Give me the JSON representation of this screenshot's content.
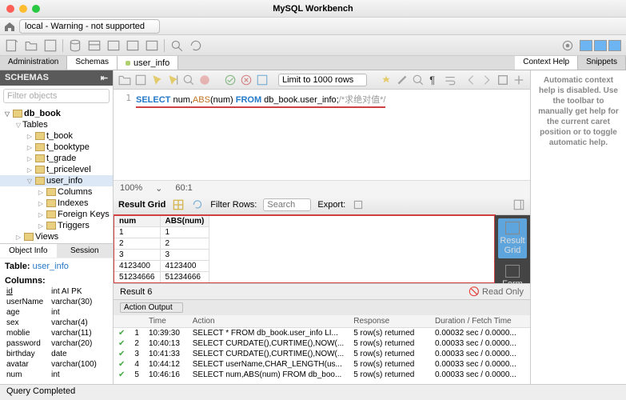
{
  "app_title": "MySQL Workbench",
  "connection_tab": "local - Warning - not supported",
  "top_tabs": {
    "admin": "Administration",
    "schemas": "Schemas",
    "editor": "user_info",
    "context": "Context Help",
    "snippets": "Snippets"
  },
  "sidebar": {
    "title": "SCHEMAS",
    "search_placeholder": "Filter objects",
    "db": "db_book",
    "tables_label": "Tables",
    "tables": [
      "t_book",
      "t_booktype",
      "t_grade",
      "t_pricelevel"
    ],
    "active_table": "user_info",
    "children": [
      "Columns",
      "Indexes",
      "Foreign Keys",
      "Triggers"
    ],
    "views": "Views",
    "tabs": {
      "object": "Object Info",
      "session": "Session"
    },
    "info_prefix": "Table:",
    "info_table": "user_info",
    "cols_header": "Columns:",
    "cols": [
      {
        "n": "id",
        "t": "int AI PK"
      },
      {
        "n": "userName",
        "t": "varchar(30)"
      },
      {
        "n": "age",
        "t": "int"
      },
      {
        "n": "sex",
        "t": "varchar(4)"
      },
      {
        "n": "moblie",
        "t": "varchar(11)"
      },
      {
        "n": "password",
        "t": "varchar(20)"
      },
      {
        "n": "birthday",
        "t": "date"
      },
      {
        "n": "avatar",
        "t": "varchar(100)"
      },
      {
        "n": "num",
        "t": "int"
      }
    ]
  },
  "editor_toolbar": {
    "limit": "Limit to 1000 rows"
  },
  "sql": {
    "line_no": "1",
    "select": "SELECT",
    "cols": " num,",
    "abs": "ABS",
    "args": "(num) ",
    "from": "FROM",
    "table": " db_book.user_info",
    "semi": ";",
    "comment": "/*求绝对值*/",
    "zoom": "100%",
    "pos": "60:1"
  },
  "result_toolbar": {
    "label": "Result Grid",
    "filter": "Filter Rows:",
    "search_ph": "Search",
    "export": "Export:"
  },
  "grid": {
    "headers": [
      "num",
      "ABS(num)"
    ],
    "rows": [
      [
        "1",
        "1"
      ],
      [
        "2",
        "2"
      ],
      [
        "3",
        "3"
      ],
      [
        "4123400",
        "4123400"
      ],
      [
        "51234666",
        "51234666"
      ]
    ]
  },
  "side_panel": {
    "result_grid": "Result Grid",
    "form_editor": "Form Editor"
  },
  "result_tabs": {
    "name": "Result 6",
    "read_only": "Read Only"
  },
  "action": {
    "selector": "Action Output",
    "headers": {
      "time": "Time",
      "action": "Action",
      "response": "Response",
      "duration": "Duration / Fetch Time"
    },
    "rows": [
      {
        "n": "1",
        "t": "10:39:30",
        "a": "SELECT * FROM db_book.user_info LI...",
        "r": "5 row(s) returned",
        "d": "0.00032 sec / 0.0000..."
      },
      {
        "n": "2",
        "t": "10:40:13",
        "a": "SELECT CURDATE(),CURTIME(),NOW(...",
        "r": "5 row(s) returned",
        "d": "0.00033 sec / 0.0000..."
      },
      {
        "n": "3",
        "t": "10:41:33",
        "a": "SELECT CURDATE(),CURTIME(),NOW(...",
        "r": "5 row(s) returned",
        "d": "0.00033 sec / 0.0000..."
      },
      {
        "n": "4",
        "t": "10:44:12",
        "a": "SELECT userName,CHAR_LENGTH(us...",
        "r": "5 row(s) returned",
        "d": "0.00033 sec / 0.0000..."
      },
      {
        "n": "5",
        "t": "10:46:16",
        "a": "SELECT num,ABS(num) FROM db_boo...",
        "r": "5 row(s) returned",
        "d": "0.00033 sec / 0.0000..."
      }
    ]
  },
  "footer": {
    "status": "Query Completed"
  },
  "help": "Automatic context help is disabled. Use the toolbar to manually get help for the current caret position or to toggle automatic help."
}
